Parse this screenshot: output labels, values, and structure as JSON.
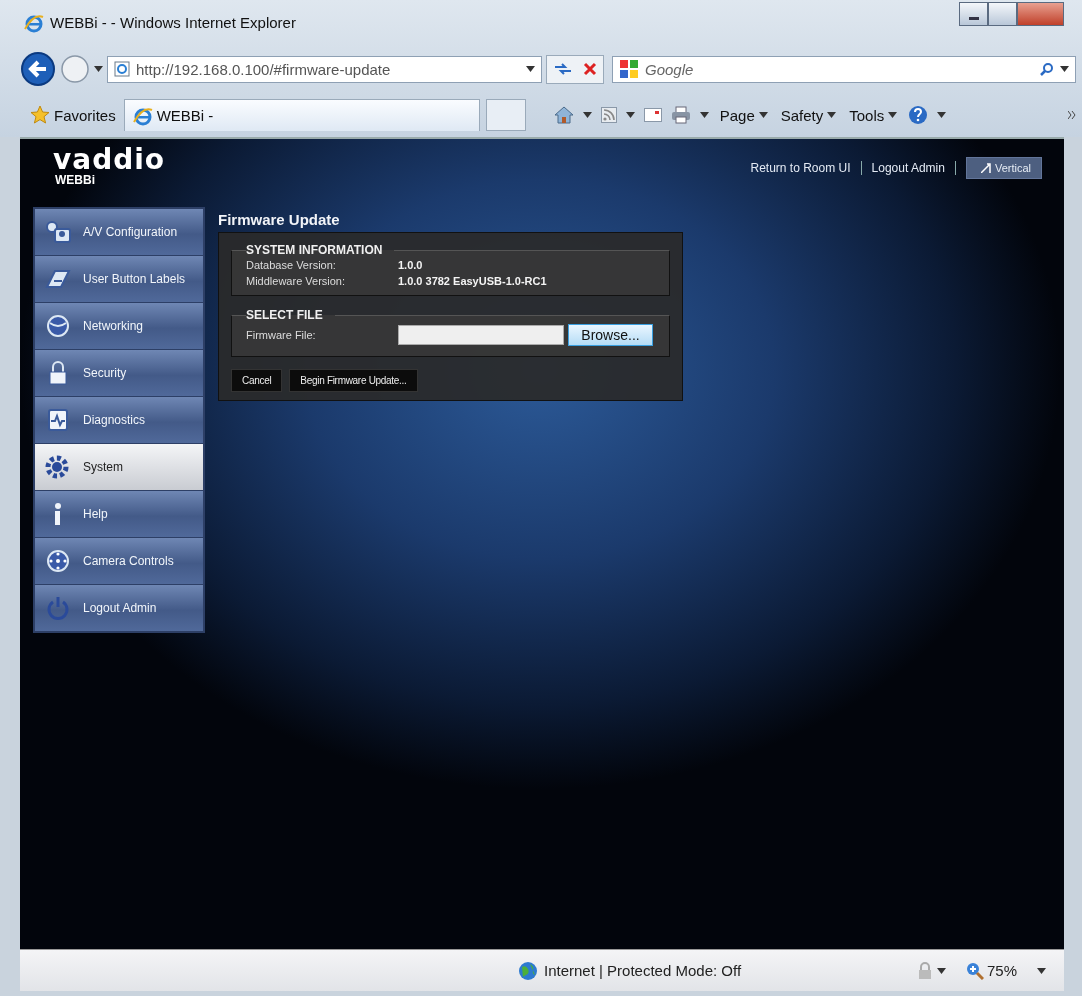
{
  "window": {
    "title": "WEBBi - - Windows Internet Explorer"
  },
  "address_bar": {
    "url": "http://192.168.0.100/#firmware-update"
  },
  "search": {
    "placeholder": "Google"
  },
  "favorites": "Favorites",
  "tabs": [
    {
      "label": "WEBBi -",
      "selected": true
    }
  ],
  "commands": [
    "Page",
    "Safety",
    "Tools"
  ],
  "app": {
    "logo": "vaddio",
    "product": "WEBBi",
    "header_links": [
      "Return to Room UI",
      "Logout Admin"
    ],
    "view_button": "Vertical",
    "nav": [
      {
        "label": "A/V Configuration",
        "selected": false
      },
      {
        "label": "User Button Labels",
        "selected": false
      },
      {
        "label": "Networking",
        "selected": false
      },
      {
        "label": "Security",
        "selected": false
      },
      {
        "label": "Diagnostics",
        "selected": false
      },
      {
        "label": "System",
        "selected": true
      },
      {
        "label": "Help",
        "selected": false
      },
      {
        "label": "Camera Controls",
        "selected": false
      },
      {
        "label": "Logout Admin",
        "selected": false
      }
    ],
    "page_title": "Firmware Update",
    "system_information": {
      "heading": "SYSTEM INFORMATION",
      "rows": [
        {
          "label": "Database Version:",
          "value": "1.0.0"
        },
        {
          "label": "Middleware Version:",
          "value": "1.0.0 3782 EasyUSB-1.0-RC1"
        }
      ]
    },
    "select_file": {
      "heading": "SELECT FILE",
      "label": "Firmware File:",
      "browse": "Browse..."
    },
    "buttons": [
      "Cancel",
      "Begin Firmware Update..."
    ]
  },
  "status_bar": {
    "zone": "Internet | Protected Mode: Off",
    "zoom": "75%"
  }
}
